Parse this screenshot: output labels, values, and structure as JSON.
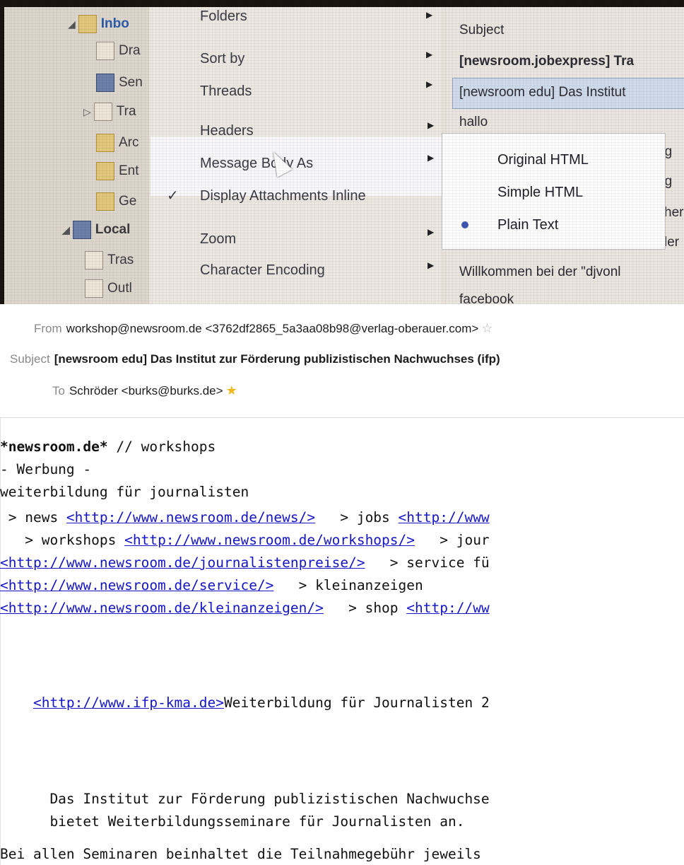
{
  "folders": [
    {
      "label": "Inbo",
      "selected": true
    },
    {
      "label": "Dra"
    },
    {
      "label": "Sen"
    },
    {
      "label": "Tra"
    },
    {
      "label": "Arc"
    },
    {
      "label": "Ent"
    },
    {
      "label": "Ge"
    },
    {
      "label": "Local",
      "bold": true
    },
    {
      "label": "Tras"
    },
    {
      "label": "Outl"
    }
  ],
  "view_menu": {
    "items": [
      "Folders",
      "Sort by",
      "Threads",
      "Headers",
      "Message Body As",
      "Display Attachments Inline",
      "Zoom",
      "Character Encoding"
    ],
    "check": "✓"
  },
  "body_as_submenu": {
    "items": [
      "Original HTML",
      "Simple HTML",
      "Plain Text"
    ],
    "selected": "Plain Text"
  },
  "message_list": {
    "header": "Subject",
    "rows": [
      "[newsroom.jobexpress] Tra",
      "[newsroom edu] Das Institut",
      "hallo",
      "ng",
      "ng",
      "her",
      "ler",
      "Willkommen bei der \"djvonl",
      "facebook"
    ]
  },
  "header": {
    "from_label": "From",
    "from_value": "workshop@newsroom.de <3762df2865_5a3aa08b98@verlag-oberauer.com>",
    "subject_label": "Subject",
    "subject_value": "[newsroom edu] Das Institut zur Förderung publizistischen Nachwuchses (ifp)",
    "to_label": "To",
    "to_value": "Schröder <burks@burks.de>"
  },
  "body": {
    "l1_bold": "*newsroom.de*",
    "l1_rest": " // workshops",
    "l2": "- Werbung -",
    "l3": "weiterbildung für journalisten",
    "l4a": " > news ",
    "l4_link": "<http://www.newsroom.de/news/>",
    "l4b": "   > jobs ",
    "l4_link2": "<http://www",
    "l5a": "   > workshops ",
    "l5_link": "<http://www.newsroom.de/workshops/>",
    "l5b": "   > jour",
    "l6_link": "<http://www.newsroom.de/journalistenpreise/>",
    "l6b": "   > service fü",
    "l7_link": "<http://www.newsroom.de/service/>",
    "l7b": "   > kleinanzeigen",
    "l8_link": "<http://www.newsroom.de/kleinanzeigen/>",
    "l8b": "   > shop ",
    "l8_link2": "<http://ww",
    "l9a": "    ",
    "l9_link": "<http://www.ifp-kma.de>",
    "l9b": "Weiterbildung für Journalisten 2",
    "l10": "      Das Institut zur Förderung publizistischen Nachwuchse",
    "l11": "      bietet Weiterbildungsseminare für Journalisten an.",
    "l12": "Bei allen Seminaren beinhaltet die Teilnahmegebühr jeweils"
  }
}
